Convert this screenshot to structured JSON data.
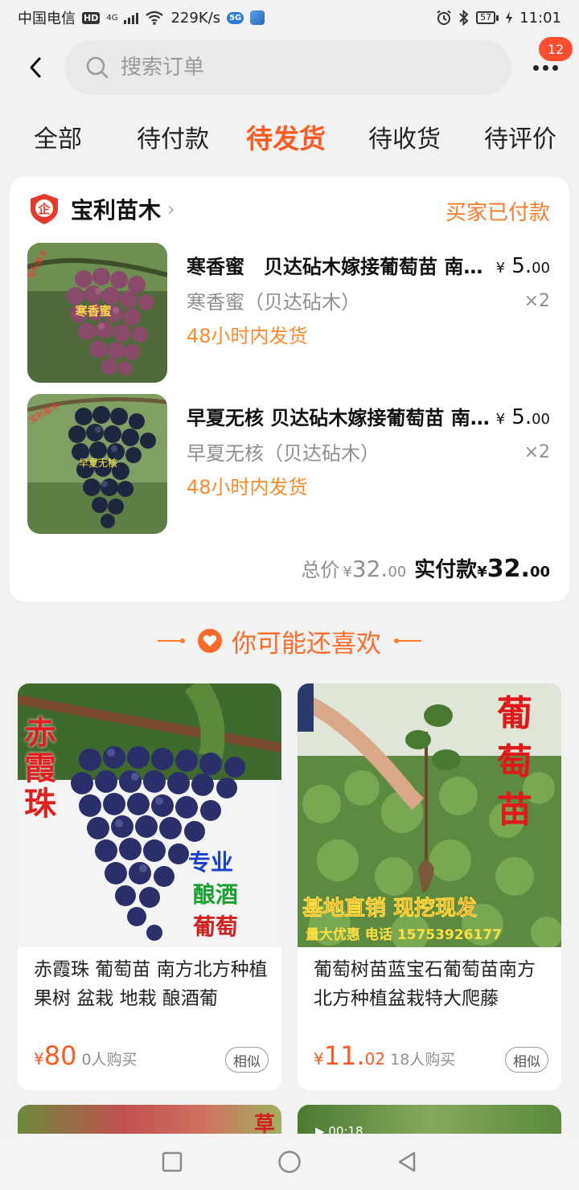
{
  "status_bar": {
    "carrier": "中国电信",
    "hd": "HD",
    "net_gen": "4G",
    "speed": "229K/s",
    "badge_5g": "5G",
    "battery": "57",
    "time": "11:01"
  },
  "header": {
    "search_placeholder": "搜索订单",
    "message_count": "12"
  },
  "tabs": [
    {
      "label": "全部",
      "active": false
    },
    {
      "label": "待付款",
      "active": false
    },
    {
      "label": "待发货",
      "active": true
    },
    {
      "label": "待收货",
      "active": false
    },
    {
      "label": "待评价",
      "active": false
    }
  ],
  "order": {
    "shop_name": "宝利苗木",
    "shop_badge": "企",
    "status": "买家已付款",
    "items": [
      {
        "title": "寒香蜜　贝达砧木嫁接葡萄苗 南方北方种植",
        "spec": "寒香蜜（贝达砧木）",
        "ship": "48小时内发货",
        "price_currency": "¥",
        "price_int": "5.",
        "price_dec": "00",
        "qty": "×2",
        "thumb_label": "寒香蜜",
        "thumb_corner": "宝利苗木"
      },
      {
        "title": "早夏无核  贝达砧木嫁接葡萄苗 南方北方种植",
        "spec": "早夏无核（贝达砧木）",
        "ship": "48小时内发货",
        "price_currency": "¥",
        "price_int": "5.",
        "price_dec": "00",
        "qty": "×2",
        "thumb_label": "早夏无核",
        "thumb_corner": "宝利苗木"
      }
    ],
    "total_label": "总价",
    "total_currency": "¥",
    "total_int": "32.",
    "total_dec": "00",
    "paid_label": "实付款",
    "paid_currency": "¥",
    "paid_int": "32.",
    "paid_dec": "00"
  },
  "recommend": {
    "title": "你可能还喜欢",
    "products": [
      {
        "title": "赤霞珠 葡萄苗 南方北方种植果树 盆栽 地栽 酿酒葡",
        "currency": "¥",
        "price_int": "80",
        "price_dec": "",
        "sold": "0人购买",
        "similar": "相似",
        "img_text_v": "赤霞珠",
        "img_text_1": "专业",
        "img_text_2": "酿酒",
        "img_text_3": "葡萄"
      },
      {
        "title": "葡萄树苗蓝宝石葡萄苗南方北方种植盆栽特大爬藤",
        "currency": "¥",
        "price_int": "11.",
        "price_dec": "02",
        "sold": "18人购买",
        "similar": "相似",
        "img_text_v": "葡萄苗",
        "img_text_1": "基地直销 现挖现发",
        "img_text_2": "量大优惠 电话 15753926177"
      }
    ],
    "peek_right_time": "00:18",
    "peek_left_text": "草"
  },
  "colors": {
    "accent": "#ff5a1f",
    "status_orange": "#ff7a2a",
    "badge_red": "#ff4d2e"
  }
}
